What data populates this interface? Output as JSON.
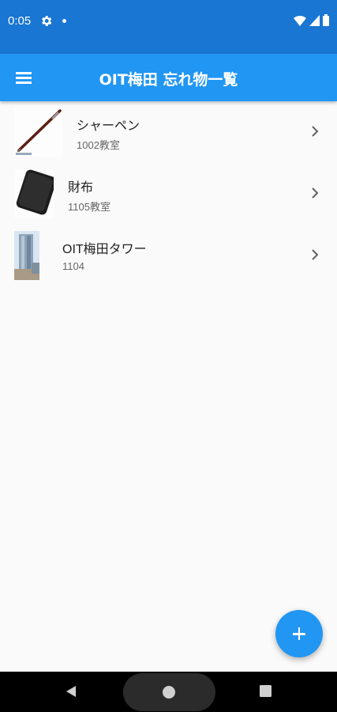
{
  "status_bar": {
    "time": "0:05",
    "icons": [
      "gear-icon",
      "notification-dot",
      "wifi-icon",
      "signal-icon",
      "battery-icon"
    ]
  },
  "app_bar": {
    "title": "OIT梅田 忘れ物一覧",
    "menu_icon": "menu-icon",
    "background": "#2196f3"
  },
  "items": [
    {
      "title": "シャーペン",
      "subtitle": "1002教室",
      "image": "mechanical-pencil-photo"
    },
    {
      "title": "財布",
      "subtitle": "1105教室",
      "image": "black-wallet-photo"
    },
    {
      "title": "OIT梅田タワー",
      "subtitle": "1104",
      "image": "tower-building-photo"
    }
  ],
  "fab": {
    "icon": "plus-icon",
    "color": "#2196f3"
  },
  "nav": {
    "icons": [
      "back-icon",
      "home-icon",
      "recents-icon"
    ]
  }
}
